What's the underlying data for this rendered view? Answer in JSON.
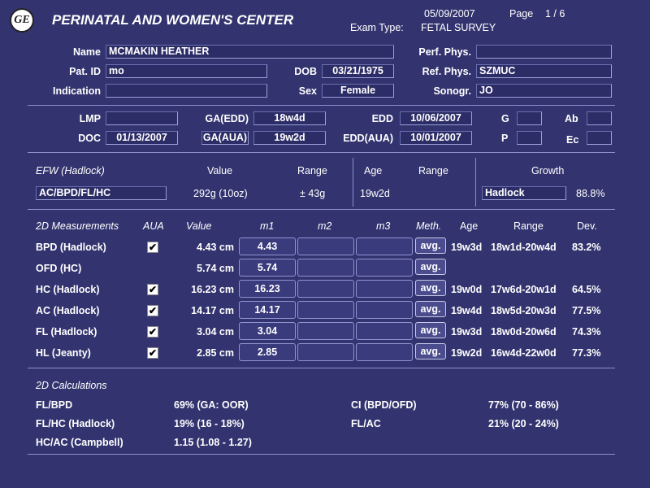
{
  "header": {
    "title": "PERINATAL AND WOMEN'S CENTER",
    "date": "05/09/2007",
    "page_label": "Page",
    "page_value": "1 / 6",
    "exam_type_label": "Exam Type:",
    "exam_type_value": "FETAL SURVEY",
    "logo_text": "GE"
  },
  "patient": {
    "name_label": "Name",
    "name_value": "MCMAKIN HEATHER",
    "patid_label": "Pat. ID",
    "patid_value": "mo",
    "indication_label": "Indication",
    "indication_value": "",
    "dob_label": "DOB",
    "dob_value": "03/21/1975",
    "sex_label": "Sex",
    "sex_value": "Female",
    "perf_label": "Perf. Phys.",
    "perf_value": "",
    "ref_label": "Ref. Phys.",
    "ref_value": "SZMUC",
    "sono_label": "Sonogr.",
    "sono_value": "JO"
  },
  "dates": {
    "lmp_label": "LMP",
    "lmp_value": "",
    "doc_label": "DOC",
    "doc_value": "01/13/2007",
    "gaedd_label": "GA(EDD)",
    "gaedd_value": "18w4d",
    "gaaua_label": "GA(AUA)",
    "gaaua_value": "19w2d",
    "edd_label": "EDD",
    "edd_value": "10/06/2007",
    "eddaua_label": "EDD(AUA)",
    "eddaua_value": "10/01/2007",
    "g_label": "G",
    "g_value": "",
    "p_label": "P",
    "p_value": "",
    "ab_label": "Ab",
    "ab_value": "",
    "ec_label": "Ec",
    "ec_value": ""
  },
  "efw": {
    "header": "EFW (Hadlock)",
    "value_header": "Value",
    "range_header": "Range",
    "age_header": "Age",
    "range2_header": "Range",
    "growth_header": "Growth",
    "method": "AC/BPD/FL/HC",
    "value": "292g (10oz)",
    "range": "± 43g",
    "age": "19w2d",
    "growth_method": "Hadlock",
    "growth_value": "88.8%"
  },
  "measurements": {
    "headers": {
      "title": "2D Measurements",
      "aua": "AUA",
      "value": "Value",
      "m1": "m1",
      "m2": "m2",
      "m3": "m3",
      "meth": "Meth.",
      "age": "Age",
      "range": "Range",
      "dev": "Dev."
    },
    "rows": [
      {
        "name": "BPD (Hadlock)",
        "aua": true,
        "value": "4.43 cm",
        "m1": "4.43",
        "m2": "",
        "m3": "",
        "meth": "avg.",
        "age": "19w3d",
        "range": "18w1d-20w4d",
        "dev": "83.2%"
      },
      {
        "name": "OFD (HC)",
        "aua": false,
        "value": "5.74 cm",
        "m1": "5.74",
        "m2": "",
        "m3": "",
        "meth": "avg.",
        "age": "",
        "range": "",
        "dev": ""
      },
      {
        "name": "HC (Hadlock)",
        "aua": true,
        "value": "16.23 cm",
        "m1": "16.23",
        "m2": "",
        "m3": "",
        "meth": "avg.",
        "age": "19w0d",
        "range": "17w6d-20w1d",
        "dev": "64.5%"
      },
      {
        "name": "AC (Hadlock)",
        "aua": true,
        "value": "14.17 cm",
        "m1": "14.17",
        "m2": "",
        "m3": "",
        "meth": "avg.",
        "age": "19w4d",
        "range": "18w5d-20w3d",
        "dev": "77.5%"
      },
      {
        "name": "FL (Hadlock)",
        "aua": true,
        "value": "3.04 cm",
        "m1": "3.04",
        "m2": "",
        "m3": "",
        "meth": "avg.",
        "age": "19w3d",
        "range": "18w0d-20w6d",
        "dev": "74.3%"
      },
      {
        "name": "HL (Jeanty)",
        "aua": true,
        "value": "2.85 cm",
        "m1": "2.85",
        "m2": "",
        "m3": "",
        "meth": "avg.",
        "age": "19w2d",
        "range": "16w4d-22w0d",
        "dev": "77.3%"
      }
    ]
  },
  "calculations": {
    "title": "2D Calculations",
    "left": [
      {
        "name": "FL/BPD",
        "value": "69% (GA: OOR)"
      },
      {
        "name": "FL/HC (Hadlock)",
        "value": "19% (16 - 18%)"
      },
      {
        "name": "HC/AC (Campbell)",
        "value": "1.15 (1.08 - 1.27)"
      }
    ],
    "right": [
      {
        "name": "CI (BPD/OFD)",
        "value": "77% (70 - 86%)"
      },
      {
        "name": "FL/AC",
        "value": "21% (20 - 24%)"
      }
    ]
  },
  "colors": {
    "background": "#33346f",
    "field": "#2c2d66",
    "border": "#9aa0d8"
  }
}
